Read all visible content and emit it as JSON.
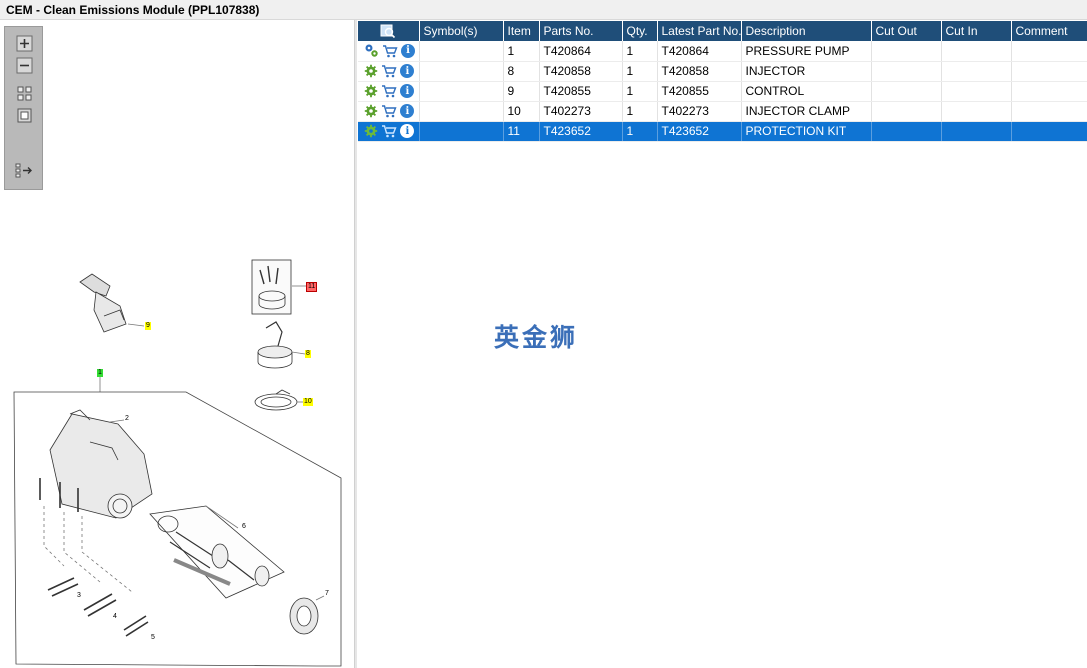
{
  "window": {
    "title": "CEM - Clean Emissions Module (PPL107838)"
  },
  "toolbar": {
    "buttons": [
      {
        "name": "zoom-in-button",
        "icon": "zoom-in-icon"
      },
      {
        "name": "zoom-out-button",
        "icon": "zoom-out-icon"
      },
      {
        "name": "fit-all-button",
        "icon": "fit-grid-icon"
      },
      {
        "name": "fit-page-button",
        "icon": "fit-page-icon"
      },
      {
        "name": "export-list-button",
        "icon": "export-list-icon"
      }
    ]
  },
  "drawing": {
    "callouts": [
      {
        "label": "9",
        "style": "yellow"
      },
      {
        "label": "11",
        "style": "red"
      },
      {
        "label": "8",
        "style": "yellow"
      },
      {
        "label": "10",
        "style": "yellow"
      },
      {
        "label": "1",
        "style": "green"
      },
      {
        "label": "2",
        "style": "plain"
      },
      {
        "label": "6",
        "style": "plain"
      },
      {
        "label": "3",
        "style": "plain"
      },
      {
        "label": "4",
        "style": "plain"
      },
      {
        "label": "5",
        "style": "plain"
      },
      {
        "label": "7",
        "style": "plain"
      }
    ]
  },
  "table": {
    "header_icon": "search-list-icon",
    "columns": [
      "Symbol(s)",
      "Item",
      "Parts No.",
      "Qty.",
      "Latest Part No.",
      "Description",
      "Cut Out",
      "Cut In",
      "Comment"
    ],
    "rows": [
      {
        "action_icon": "assembly-gears-icon",
        "symbols": "",
        "item": "1",
        "part_no": "T420864",
        "qty": "1",
        "latest_part_no": "T420864",
        "description": "PRESSURE PUMP",
        "cut_out": "",
        "cut_in": "",
        "comment": "",
        "selected": false
      },
      {
        "action_icon": "gear-icon",
        "symbols": "",
        "item": "8",
        "part_no": "T420858",
        "qty": "1",
        "latest_part_no": "T420858",
        "description": "INJECTOR",
        "cut_out": "",
        "cut_in": "",
        "comment": "",
        "selected": false
      },
      {
        "action_icon": "gear-icon",
        "symbols": "",
        "item": "9",
        "part_no": "T420855",
        "qty": "1",
        "latest_part_no": "T420855",
        "description": "CONTROL",
        "cut_out": "",
        "cut_in": "",
        "comment": "",
        "selected": false
      },
      {
        "action_icon": "gear-icon",
        "symbols": "",
        "item": "10",
        "part_no": "T402273",
        "qty": "1",
        "latest_part_no": "T402273",
        "description": "INJECTOR CLAMP",
        "cut_out": "",
        "cut_in": "",
        "comment": "",
        "selected": false
      },
      {
        "action_icon": "gear-icon",
        "symbols": "",
        "item": "11",
        "part_no": "T423652",
        "qty": "1",
        "latest_part_no": "T423652",
        "description": "PROTECTION KIT",
        "cut_out": "",
        "cut_in": "",
        "comment": "",
        "selected": true
      }
    ]
  },
  "watermark": {
    "text": "英金狮"
  },
  "colors": {
    "header_bg": "#1f4e79",
    "selected_bg": "#0f74d3",
    "gear": "#5aa02c",
    "cart": "#2e6fbf",
    "info": "#2e7fd0"
  }
}
